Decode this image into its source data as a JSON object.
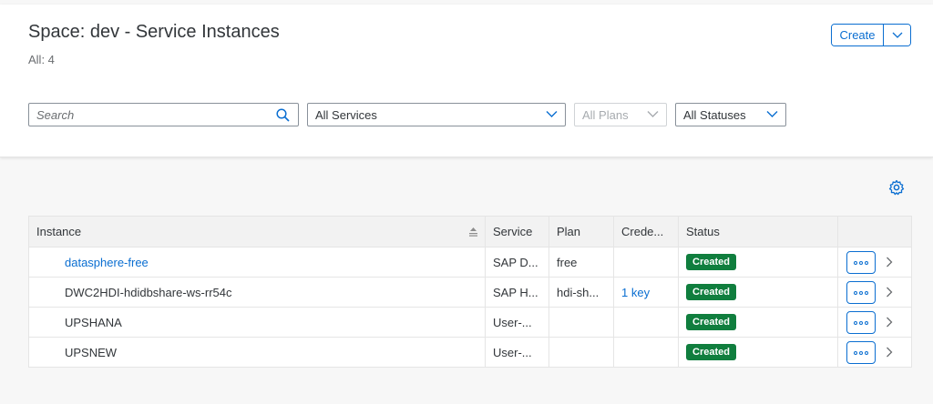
{
  "header": {
    "title": "Space: dev - Service Instances",
    "count": "All: 4",
    "create_label": "Create"
  },
  "filters": {
    "search_placeholder": "Search",
    "services": "All Services",
    "plans": "All Plans",
    "statuses": "All Statuses"
  },
  "table": {
    "columns": [
      "Instance",
      "Service",
      "Plan",
      "Crede...",
      "Status"
    ],
    "rows": [
      {
        "instance": "datasphere-free",
        "service": "SAP D...",
        "plan": "free",
        "credentials": "",
        "status": "Created"
      },
      {
        "instance": "DWC2HDI-hdidbshare-ws-rr54c",
        "service": "SAP H...",
        "plan": "hdi-sh...",
        "credentials": "1 key",
        "status": "Created"
      },
      {
        "instance": "UPSHANA",
        "service": "User-...",
        "plan": "",
        "credentials": "",
        "status": "Created"
      },
      {
        "instance": "UPSNEW",
        "service": "User-...",
        "plan": "",
        "credentials": "",
        "status": "Created"
      }
    ]
  },
  "colors": {
    "accent": "#0a6ed1",
    "status_created": "#107e3e",
    "header_bg": "#f2f2f2"
  },
  "icons": [
    "search-icon",
    "chevron-down-icon",
    "gear-icon",
    "sort-icon",
    "more-icon",
    "chevron-right-icon"
  ]
}
